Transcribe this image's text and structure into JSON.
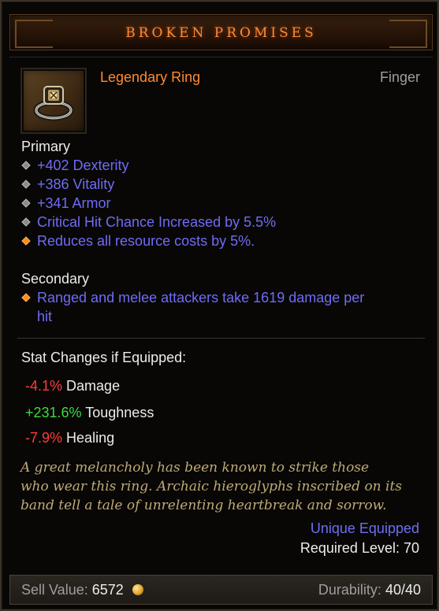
{
  "item": {
    "name": "BROKEN PROMISES",
    "type": "Legendary Ring",
    "slot": "Finger",
    "icon": "ring-icon"
  },
  "primary": {
    "label": "Primary",
    "stats": [
      "+402 Dexterity",
      "+386 Vitality",
      "+341 Armor",
      "Critical Hit Chance Increased by 5.5%",
      "Reduces all resource costs by 5%."
    ]
  },
  "secondary": {
    "label": "Secondary",
    "stats_line1": "Ranged and melee attackers take 1619 damage per",
    "stats_line2": "hit"
  },
  "stat_changes": {
    "label": "Stat Changes if Equipped:",
    "rows": [
      {
        "value": "-4.1%",
        "name": "Damage"
      },
      {
        "value": "+231.6%",
        "name": "Toughness"
      },
      {
        "value": "-7.9%",
        "name": "Healing"
      }
    ]
  },
  "flavor": {
    "line1": "A great melancholy has been known to strike those",
    "line2": "who wear this ring. Archaic hieroglyphs inscribed on its",
    "line3": "band tell a tale of unrelenting heartbreak and sorrow."
  },
  "unique_equipped": "Unique Equipped",
  "required_level": "Required Level: 70",
  "footer": {
    "sell_label": "Sell Value:",
    "sell_value": "6572",
    "gold_icon": "gold-coin-icon",
    "durability_label": "Durability:",
    "durability_value": "40/40"
  },
  "colors": {
    "legendary": "#ff8a33",
    "magic": "#6f6cf5",
    "negative": "#ff3b3b",
    "positive": "#3ddc3d",
    "flavor": "#bfaa77"
  }
}
